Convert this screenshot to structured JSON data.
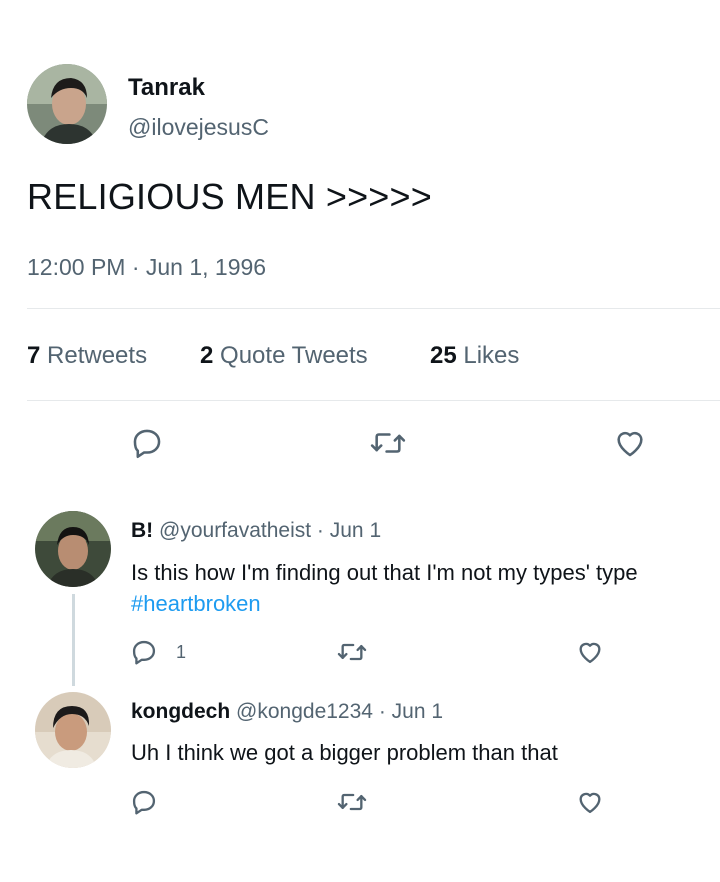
{
  "tweet": {
    "author_name": "Tanrak",
    "author_handle": "@ilovejesusC",
    "text": "RELIGIOUS MEN >>>>>",
    "timestamp": "12:00 PM · Jun 1, 1996",
    "stats": {
      "retweets_count": "7",
      "retweets_label": "Retweets",
      "quotes_count": "2",
      "quotes_label": "Quote Tweets",
      "likes_count": "25",
      "likes_label": "Likes"
    },
    "actions": [
      "reply-icon",
      "retweet-icon",
      "like-icon"
    ]
  },
  "replies": [
    {
      "name": "B!",
      "handle": "@yourfavatheist",
      "date": "· Jun 1",
      "text": "Is this how I'm finding out that I'm not my types' type",
      "hashtag": "#heartbroken",
      "reply_count": "1"
    },
    {
      "name": "kongdech",
      "handle": "@kongde1234",
      "date": "· Jun 1",
      "text": "Uh I think we got a bigger problem than that",
      "reply_count": ""
    }
  ],
  "colors": {
    "text": "#0f1419",
    "secondary": "#536471",
    "accent": "#1d9bf0",
    "divider": "#e6e9eb"
  }
}
